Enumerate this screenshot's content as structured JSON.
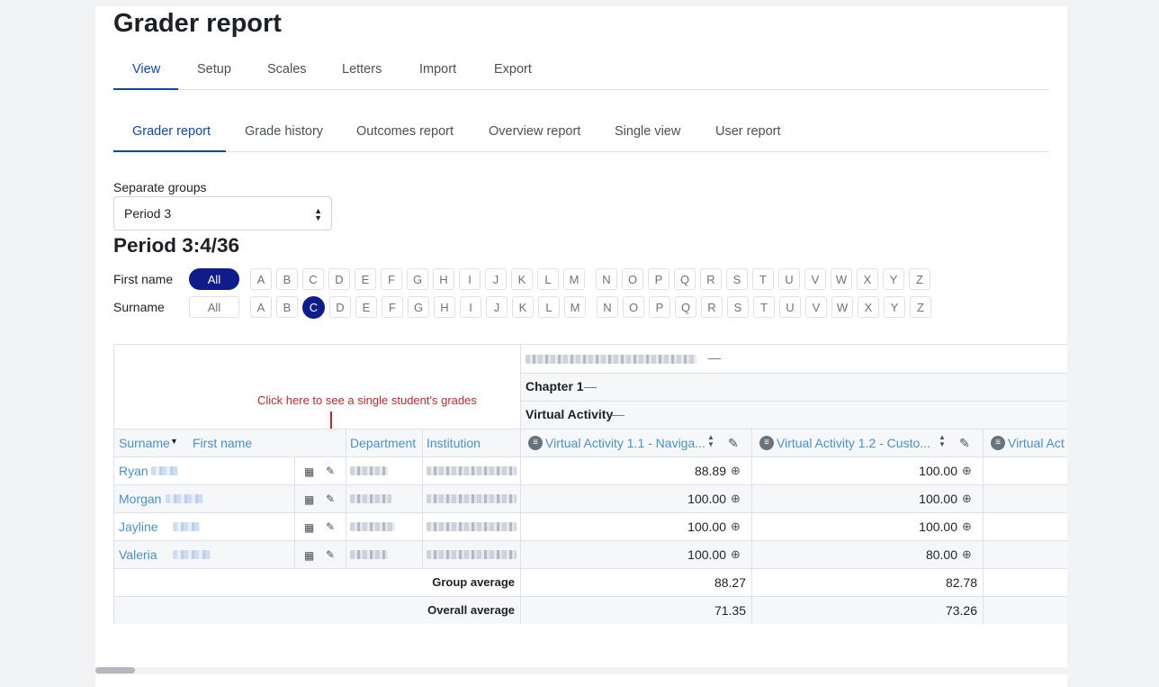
{
  "page_title": "Grader report",
  "main_tabs": [
    "View",
    "Setup",
    "Scales",
    "Letters",
    "Import",
    "Export"
  ],
  "report_tabs": [
    "Grader report",
    "Grade history",
    "Outcomes report",
    "Overview report",
    "Single view",
    "User report"
  ],
  "group_selector": {
    "label": "Separate groups",
    "value": "Period 3"
  },
  "period_heading": "Period 3:4/36",
  "initials": {
    "first_label": "First name",
    "surname_label": "Surname",
    "all_label": "All",
    "letters": [
      "A",
      "B",
      "C",
      "D",
      "E",
      "F",
      "G",
      "H",
      "I",
      "J",
      "K",
      "L",
      "M",
      "N",
      "O",
      "P",
      "Q",
      "R",
      "S",
      "T",
      "U",
      "V",
      "W",
      "X",
      "Y",
      "Z"
    ],
    "first_selected": "All",
    "surname_selected": "C"
  },
  "annotation": "Click here to see a single student's grades",
  "table": {
    "category": "Chapter 1",
    "subcategory": "Virtual Activity",
    "headers": {
      "surname": "Surname",
      "first_name": "First name",
      "department": "Department",
      "institution": "Institution",
      "activities": [
        "Virtual Activity 1.1 - Naviga...",
        "Virtual Activity 1.2 - Custo...",
        "Virtual Act"
      ]
    },
    "rows": [
      {
        "name": "Ryan",
        "a1": "88.89",
        "a2": "100.00"
      },
      {
        "name": "Morgan",
        "a1": "100.00",
        "a2": "100.00"
      },
      {
        "name": "Jayline",
        "a1": "100.00",
        "a2": "100.00"
      },
      {
        "name": "Valeria",
        "a1": "100.00",
        "a2": "80.00"
      }
    ],
    "group_average": {
      "label": "Group average",
      "a1": "88.27",
      "a2": "82.78"
    },
    "overall_average": {
      "label": "Overall average",
      "a1": "71.35",
      "a2": "73.26"
    }
  },
  "colors": {
    "accent": "#0f47ad",
    "link": "#4a90c8",
    "selected": "#0f1c8a",
    "annotation": "#c0282e"
  }
}
